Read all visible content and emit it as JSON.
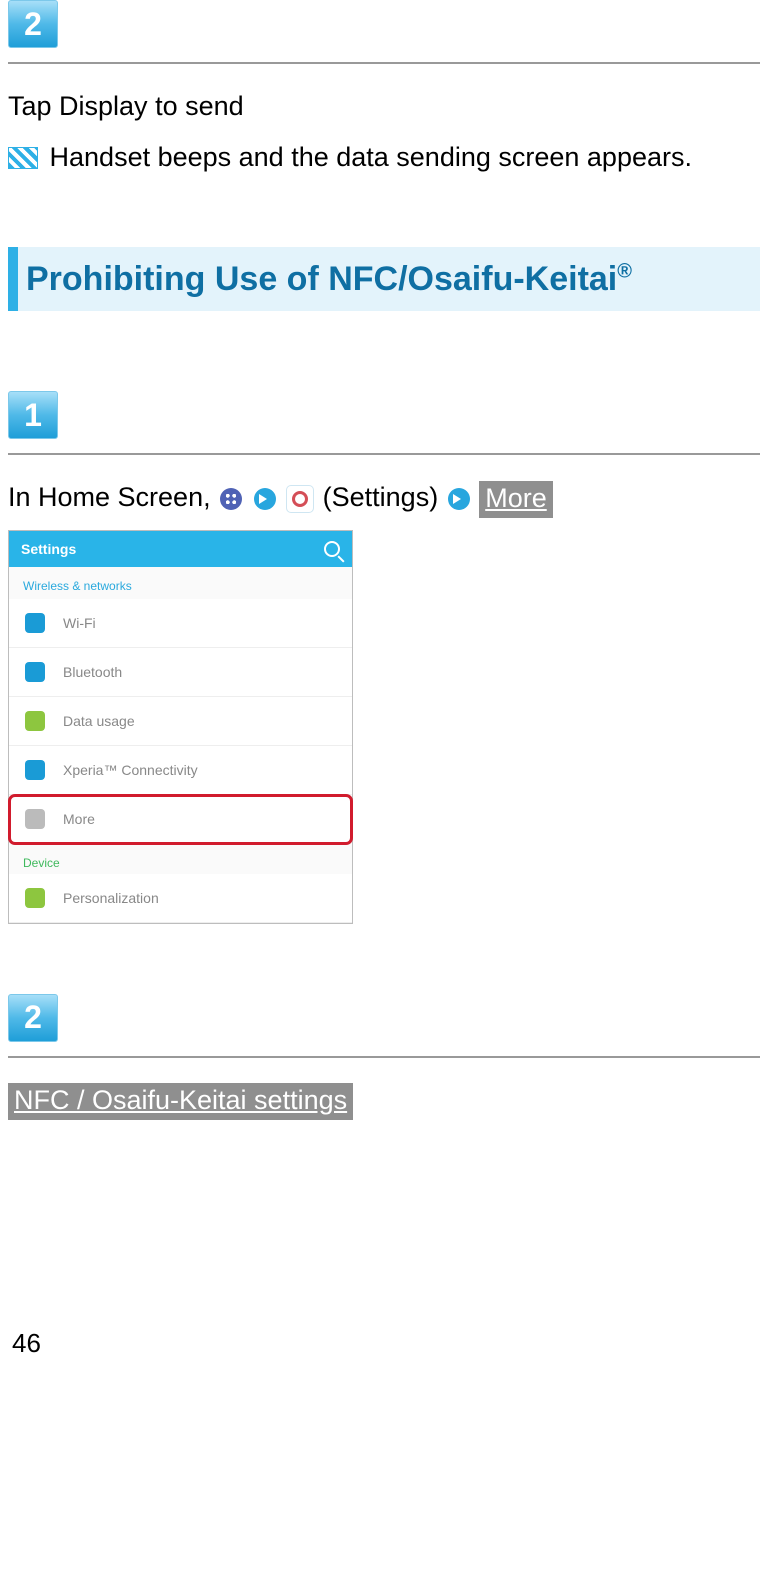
{
  "step2a": {
    "number": "2"
  },
  "line1": "Tap Display to send",
  "line2": "Handset beeps and the data sending screen appears.",
  "heading": {
    "text": "Prohibiting Use of NFC/Osaifu-Keitai",
    "sup": "®"
  },
  "step1": {
    "number": "1"
  },
  "instruction": {
    "prefix": "In Home Screen, ",
    "settings": "(Settings)",
    "more": "More"
  },
  "screenshot": {
    "title": "Settings",
    "section": "Wireless & networks",
    "items": [
      {
        "label": "Wi-Fi",
        "color": "#1a9bd6"
      },
      {
        "label": "Bluetooth",
        "color": "#1a9bd6"
      },
      {
        "label": "Data usage",
        "color": "#8dc63f"
      },
      {
        "label": "Xperia™ Connectivity",
        "color": "#1a9bd6"
      },
      {
        "label": "More",
        "color": "#bbb",
        "highlight": true
      }
    ],
    "section2": "Device",
    "items2": [
      {
        "label": "Personalization",
        "color": "#8dc63f"
      }
    ]
  },
  "step2b": {
    "number": "2"
  },
  "nfc_label": "NFC / Osaifu-Keitai settings",
  "page_number": "46"
}
